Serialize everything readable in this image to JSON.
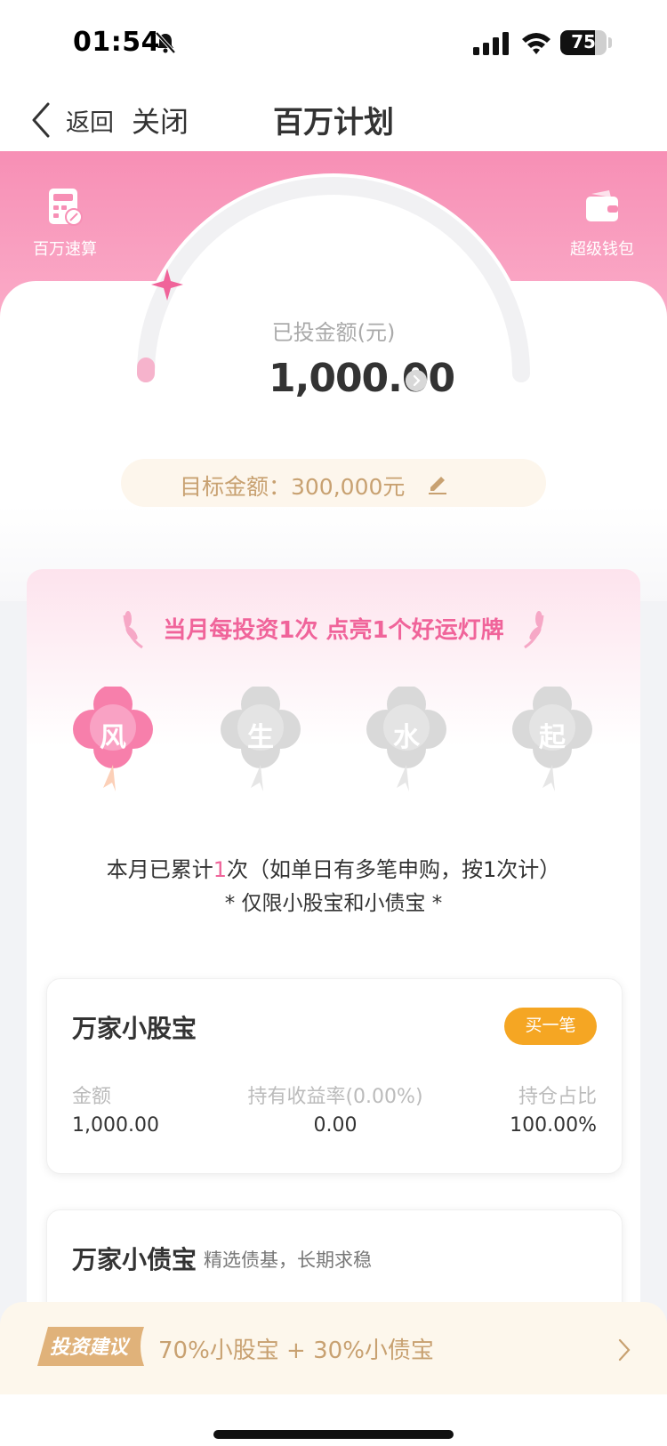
{
  "status_bar": {
    "time": "01:54",
    "battery": "75",
    "battery_level": 0.75
  },
  "nav": {
    "back_label": "返回",
    "close_label": "关闭",
    "title": "百万计划"
  },
  "header": {
    "left_action": {
      "label": "百万速算",
      "icon": "calculator-icon"
    },
    "right_action": {
      "label": "超级钱包",
      "icon": "wallet-icon"
    }
  },
  "summary": {
    "invested_label": "已投金额(元)",
    "invested_value": "1,000.00",
    "target_text": "目标金额：300,000元",
    "progress_fraction": 0.0033
  },
  "lucky": {
    "title": "当月每投资1次 点亮1个好运灯牌",
    "clovers": [
      {
        "label": "风",
        "lit": true
      },
      {
        "label": "生",
        "lit": false
      },
      {
        "label": "水",
        "lit": false
      },
      {
        "label": "起",
        "lit": false
      }
    ],
    "count_prefix": "本月已累计",
    "count_value": "1",
    "count_suffix": "次（如单日有多笔申购，按1次计）",
    "limit_note": "* 仅限小股宝和小债宝 *"
  },
  "products": [
    {
      "name": "万家小股宝",
      "buy_label": "买一笔",
      "metrics": [
        {
          "label": "金额",
          "value": "1,000.00"
        },
        {
          "label": "持有收益率(0.00%)",
          "value": "0.00"
        },
        {
          "label": "持仓占比",
          "value": "100.00%"
        }
      ]
    },
    {
      "name": "万家小债宝",
      "subtitle": "精选债基，长期求稳"
    }
  ],
  "suggestion": {
    "badge": "投资建议",
    "text": "70%小股宝 + 30%小债宝"
  },
  "colors": {
    "pink": "#f78fb5",
    "accent_pink": "#f0649a",
    "orange": "#f5a623",
    "gold_text": "#c8a171"
  }
}
